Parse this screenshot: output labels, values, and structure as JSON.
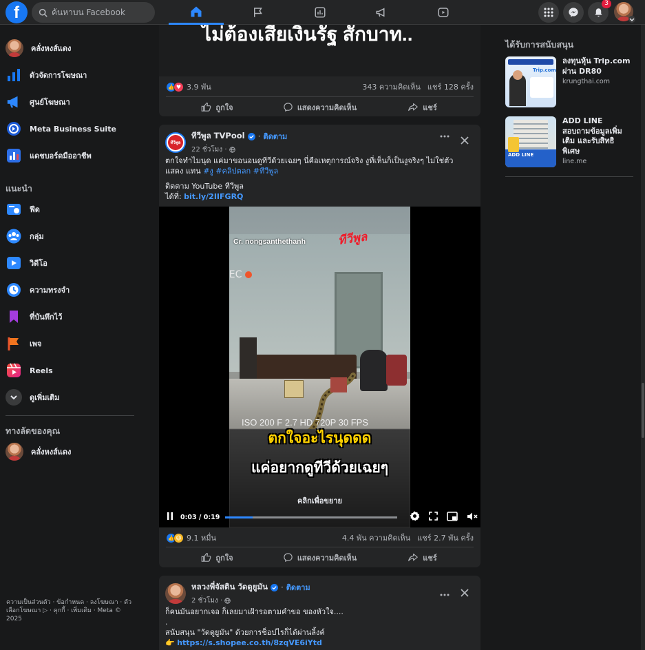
{
  "topbar": {
    "logo": "f",
    "search_placeholder": "ค้นหาบน Facebook",
    "notification_count": "3"
  },
  "sidebar": {
    "items": [
      {
        "label": "คลั่งหงส์แดง",
        "icon": "profile-avatar"
      },
      {
        "label": "ตัวจัดการโฆษณา",
        "icon": "ads-manager-icon"
      },
      {
        "label": "ศูนย์โฆษณา",
        "icon": "megaphone-icon"
      },
      {
        "label": "Meta Business Suite",
        "icon": "meta-business-icon"
      },
      {
        "label": "แดชบอร์ดมืออาชีพ",
        "icon": "dashboard-icon"
      }
    ],
    "explore_title": "แนะนำ",
    "explore": [
      {
        "label": "ฟีด",
        "icon": "feed-icon"
      },
      {
        "label": "กลุ่ม",
        "icon": "groups-icon"
      },
      {
        "label": "วิดีโอ",
        "icon": "video-icon"
      },
      {
        "label": "ความทรงจำ",
        "icon": "memories-icon"
      },
      {
        "label": "ที่บันทึกไว้",
        "icon": "saved-icon"
      },
      {
        "label": "เพจ",
        "icon": "pages-icon"
      },
      {
        "label": "Reels",
        "icon": "reels-icon"
      },
      {
        "label": "ดูเพิ่มเติม",
        "icon": "chevron-down-icon"
      }
    ],
    "shortcuts_title": "ทางลัดของคุณ",
    "shortcuts": [
      {
        "label": "คลั่งหงส์แดง"
      }
    ],
    "footer": "ความเป็นส่วนตัว · ข้อกำหนด · ลงโฆษณา · ตัวเลือกโฆษณา ▷ · คุกกี้ · เพิ่มเติม · Meta © 2025"
  },
  "post1": {
    "banner_text": "ไม่ต้องเสียเงินรัฐ สักบาท..",
    "reactions": "3.9 พัน",
    "comments": "343 ความคิดเห็น",
    "shares": "แชร์ 128 ครั้ง",
    "like_label": "ถูกใจ",
    "comment_label": "แสดงความคิดเห็น",
    "share_label": "แชร์"
  },
  "post2": {
    "page_name": "ทีวีพูล TVPool",
    "follow": "ติดตาม",
    "time": "22 ชั่วโมง ·",
    "avatar_text": "ทีวีพูล",
    "text_line1": "ตกใจทำไมนุด แค่มาขอนอนดูทีวีด้วยเฉยๆ นี่คือเหตุการณ์จริง งูที่เห็นก็เป็นงูจริงๆ ไม่ใช่ตัวแสดง แทน",
    "hashtags": "#งู #คลิปตลก #ทีวีพูล",
    "text_line2": "ติดตาม YouTube ทีวีพูล",
    "text_line3_prefix": "ได้ที่:",
    "link": "bit.ly/2IIFGRQ",
    "video": {
      "credit": "Cr. nongsanthethanh",
      "rec": "REC",
      "cam_info": "ISO 200    F 2.7    HD 720P    30 FPS",
      "caption1": "ตกใจอะไรนุดดด",
      "caption2": "แค่อยากดูทีวีด้วยเฉยๆ",
      "click_hint": "คลิกเพื่อขยาย",
      "time": "0:03 / 0:19",
      "progress": 0.16
    },
    "reactions": "9.1 หมื่น",
    "comments": "4.4 พัน ความคิดเห็น",
    "shares": "แชร์ 2.7 พัน ครั้ง",
    "like_label": "ถูกใจ",
    "comment_label": "แสดงความคิดเห็น",
    "share_label": "แชร์"
  },
  "post3": {
    "page_name": "หลวงพี่จัสติน วัดดูยูมัน",
    "follow": "ติดตาม",
    "time": "2 ชั่วโมง ·",
    "text_line1": "ก็คนมันอยากเจอ ก็เลยมาเฝ้ารอตามคำขอ ของหัวใจ....",
    "text_line2": ".",
    "text_line3": "สนับสนุน \"วัดดูยูมัน\" ด้วยการช็อปไรก็ได้ผ่านลิ้งค์",
    "emoji": "👉",
    "link": "https://s.shopee.co.th/8zqVE6iYtd"
  },
  "sponsored": {
    "title": "ได้รับการสนับสนุน",
    "ads": [
      {
        "title": "ลงทุนหุ้น Trip.com ผ่าน DR80",
        "domain": "krungthai.com",
        "thumb_text": "Trip.com"
      },
      {
        "title": "ADD LINE สอบถามข้อมูลเพิ่มเติม และรับสิทธิพิเศษ",
        "domain": "line.me",
        "thumb_text": "ADD LINE"
      }
    ]
  },
  "colors": {
    "accent": "#1877f2",
    "link": "#4599ff",
    "bg": "#18191a",
    "card": "#242526",
    "notification": "#e41e3f"
  }
}
